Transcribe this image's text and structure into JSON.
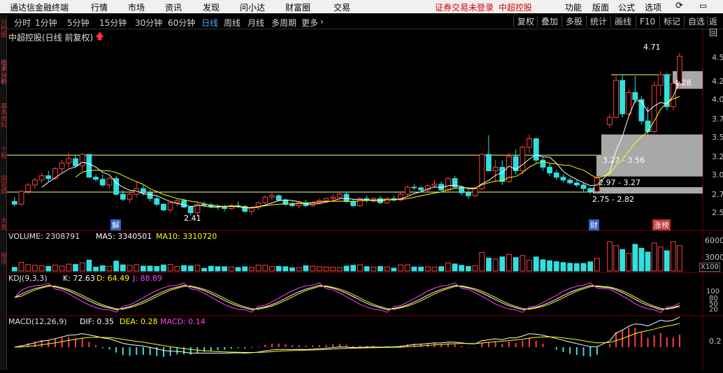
{
  "menu": {
    "app_title": "通达信金融终端",
    "items": [
      "行情",
      "市场",
      "资讯",
      "发现",
      "问小达",
      "财富圈",
      "交易"
    ],
    "alert_text": "证券交易未登录",
    "stock_link": "中超控股",
    "right_items": [
      "功能",
      "版面",
      "公式",
      "选项"
    ]
  },
  "toolbar": {
    "tabs": [
      "分时",
      "1分钟",
      "5分钟",
      "15分钟",
      "30分钟",
      "60分钟",
      "日线",
      "周线",
      "月线",
      "多周期",
      "更多"
    ],
    "active_tab": "日线",
    "buttons": [
      "复权",
      "叠加",
      "多股",
      "统计",
      "画线",
      "F10",
      "标记",
      "自选",
      "返回"
    ]
  },
  "sidebar_labels": [
    "分时图",
    "技术分析",
    "基本资料",
    "个股",
    "同花顺",
    "大盘",
    "板块"
  ],
  "chart_header": {
    "title": "中超控股(日线 前复权)"
  },
  "price_axis": [
    "4.5",
    "4.2",
    "4.0",
    "3.7",
    "3.5",
    "3.2",
    "3.0",
    "2.7",
    "2.5"
  ],
  "price_annotations": {
    "high": "4.71",
    "low": "2.41",
    "right_label": "4.28",
    "markers": [
      "解",
      "财",
      "涨榜"
    ]
  },
  "zones": [
    {
      "label": "3.27 - 3.56"
    },
    {
      "label": "2.97 - 3.27"
    },
    {
      "label": "2.75 - 2.82"
    }
  ],
  "volume_header": {
    "label": "VOLUME: 2308791",
    "ma5": "MA5: 3340501",
    "ma10": "MA10: 3310720",
    "axis": [
      "6000",
      "3000"
    ],
    "unit": "X100"
  },
  "kdj_header": {
    "label": "KDJ(9,3,3)",
    "k": "K: 72.63",
    "d": "D: 64.49",
    "j": "J: 88.89",
    "axis": [
      "100",
      "80",
      "50",
      "20"
    ]
  },
  "macd_header": {
    "label": "MACD(12,26,9)",
    "dif": "DIF: 0.35",
    "dea": "DEA: 0.28",
    "macd": "MACD: 0.14",
    "axis": [
      "0.2"
    ]
  },
  "colors": {
    "up": "#ff4040",
    "down": "#30e0e0",
    "ma_white": "#ffffff",
    "ma_yellow": "#ffff00",
    "ma_purple": "#ff40ff",
    "grid": "#800000"
  },
  "chart_data": {
    "type": "line",
    "title": "中超控股(日线 前复权)",
    "xlabel": "",
    "ylabel": "",
    "ylim": [
      2.4,
      4.8
    ],
    "candles": [
      [
        2.62,
        2.68,
        2.55,
        2.58
      ],
      [
        2.58,
        2.78,
        2.56,
        2.76
      ],
      [
        2.76,
        2.88,
        2.72,
        2.85
      ],
      [
        2.85,
        2.95,
        2.8,
        2.92
      ],
      [
        2.92,
        3.02,
        2.88,
        2.98
      ],
      [
        2.98,
        3.05,
        2.9,
        2.94
      ],
      [
        2.94,
        3.1,
        2.92,
        3.08
      ],
      [
        3.08,
        3.2,
        3.02,
        3.16
      ],
      [
        3.16,
        3.3,
        3.1,
        3.22
      ],
      [
        3.22,
        3.26,
        3.1,
        3.12
      ],
      [
        3.12,
        3.3,
        3.05,
        3.28
      ],
      [
        3.28,
        3.28,
        2.95,
        2.96
      ],
      [
        2.96,
        3.0,
        2.9,
        2.93
      ],
      [
        2.93,
        3.0,
        2.82,
        2.85
      ],
      [
        2.85,
        2.96,
        2.8,
        2.94
      ],
      [
        2.94,
        2.98,
        2.7,
        2.72
      ],
      [
        2.72,
        2.78,
        2.62,
        2.65
      ],
      [
        2.65,
        2.75,
        2.6,
        2.72
      ],
      [
        2.72,
        2.9,
        2.68,
        2.8
      ],
      [
        2.8,
        2.85,
        2.7,
        2.74
      ],
      [
        2.74,
        2.78,
        2.62,
        2.66
      ],
      [
        2.66,
        2.7,
        2.55,
        2.58
      ],
      [
        2.58,
        2.6,
        2.48,
        2.5
      ],
      [
        2.5,
        2.62,
        2.46,
        2.6
      ],
      [
        2.6,
        2.66,
        2.55,
        2.63
      ],
      [
        2.63,
        2.66,
        2.52,
        2.54
      ],
      [
        2.54,
        2.56,
        2.42,
        2.46
      ],
      [
        2.46,
        2.6,
        2.41,
        2.58
      ],
      [
        2.58,
        2.62,
        2.54,
        2.57
      ],
      [
        2.57,
        2.6,
        2.52,
        2.55
      ],
      [
        2.55,
        2.58,
        2.5,
        2.54
      ],
      [
        2.54,
        2.57,
        2.48,
        2.52
      ],
      [
        2.52,
        2.58,
        2.5,
        2.56
      ],
      [
        2.56,
        2.62,
        2.53,
        2.55
      ],
      [
        2.55,
        2.57,
        2.46,
        2.48
      ],
      [
        2.48,
        2.55,
        2.44,
        2.53
      ],
      [
        2.53,
        2.62,
        2.5,
        2.6
      ],
      [
        2.6,
        2.7,
        2.58,
        2.68
      ],
      [
        2.68,
        2.74,
        2.64,
        2.7
      ],
      [
        2.7,
        2.72,
        2.62,
        2.64
      ],
      [
        2.64,
        2.66,
        2.56,
        2.58
      ],
      [
        2.58,
        2.62,
        2.54,
        2.56
      ],
      [
        2.56,
        2.62,
        2.52,
        2.6
      ],
      [
        2.6,
        2.64,
        2.54,
        2.56
      ],
      [
        2.56,
        2.62,
        2.54,
        2.6
      ],
      [
        2.6,
        2.66,
        2.58,
        2.63
      ],
      [
        2.63,
        2.68,
        2.6,
        2.66
      ],
      [
        2.66,
        2.72,
        2.62,
        2.68
      ],
      [
        2.68,
        2.74,
        2.65,
        2.72
      ],
      [
        2.72,
        2.76,
        2.6,
        2.62
      ],
      [
        2.62,
        2.66,
        2.54,
        2.56
      ],
      [
        2.56,
        2.68,
        2.54,
        2.66
      ],
      [
        2.66,
        2.7,
        2.6,
        2.64
      ],
      [
        2.64,
        2.68,
        2.6,
        2.66
      ],
      [
        2.66,
        2.7,
        2.58,
        2.6
      ],
      [
        2.6,
        2.68,
        2.58,
        2.66
      ],
      [
        2.66,
        2.7,
        2.62,
        2.64
      ],
      [
        2.64,
        2.74,
        2.62,
        2.72
      ],
      [
        2.72,
        2.84,
        2.7,
        2.82
      ],
      [
        2.82,
        2.86,
        2.78,
        2.81
      ],
      [
        2.81,
        2.84,
        2.76,
        2.78
      ],
      [
        2.78,
        2.86,
        2.76,
        2.84
      ],
      [
        2.84,
        2.92,
        2.8,
        2.86
      ],
      [
        2.86,
        2.9,
        2.76,
        2.78
      ],
      [
        2.78,
        2.96,
        2.76,
        2.94
      ],
      [
        2.94,
        2.98,
        2.8,
        2.82
      ],
      [
        2.82,
        2.84,
        2.7,
        2.74
      ],
      [
        2.74,
        2.78,
        2.66,
        2.7
      ],
      [
        2.7,
        2.82,
        2.68,
        2.8
      ],
      [
        2.8,
        3.3,
        2.78,
        3.28
      ],
      [
        3.28,
        3.55,
        3.2,
        3.05
      ],
      [
        3.05,
        3.2,
        2.9,
        3.1
      ],
      [
        3.1,
        3.2,
        2.85,
        2.9
      ],
      [
        2.9,
        3.3,
        2.88,
        3.25
      ],
      [
        3.25,
        3.35,
        3.0,
        3.05
      ],
      [
        3.05,
        3.4,
        3.0,
        3.38
      ],
      [
        3.38,
        3.56,
        3.3,
        3.5
      ],
      [
        3.5,
        3.52,
        3.15,
        3.2
      ],
      [
        3.2,
        3.25,
        3.05,
        3.1
      ],
      [
        3.1,
        3.15,
        2.98,
        3.02
      ],
      [
        3.02,
        3.06,
        2.92,
        2.96
      ],
      [
        2.96,
        3.0,
        2.88,
        2.92
      ],
      [
        2.92,
        2.95,
        2.86,
        2.88
      ],
      [
        2.88,
        2.92,
        2.82,
        2.85
      ],
      [
        2.85,
        2.88,
        2.76,
        2.8
      ],
      [
        2.8,
        2.82,
        2.72,
        2.76
      ],
      [
        2.76,
        2.98,
        2.74,
        2.96
      ],
      [
        3.7,
        3.85,
        3.65,
        3.8
      ],
      [
        3.8,
        4.4,
        3.78,
        4.32
      ],
      [
        4.32,
        4.4,
        3.8,
        3.85
      ],
      [
        3.85,
        4.2,
        3.82,
        4.15
      ],
      [
        4.15,
        4.38,
        4.0,
        4.05
      ],
      [
        4.05,
        4.1,
        3.7,
        3.75
      ],
      [
        3.75,
        3.95,
        3.56,
        3.6
      ],
      [
        3.6,
        4.3,
        3.58,
        4.25
      ],
      [
        4.25,
        4.45,
        4.1,
        4.4
      ],
      [
        4.4,
        4.42,
        3.9,
        3.95
      ],
      [
        3.95,
        4.3,
        3.9,
        4.28
      ],
      [
        4.28,
        4.71,
        4.2,
        4.66
      ]
    ],
    "volume_ma_note": "",
    "series": [
      {
        "name": "MA5",
        "values": []
      },
      {
        "name": "MA10",
        "values": []
      }
    ]
  }
}
